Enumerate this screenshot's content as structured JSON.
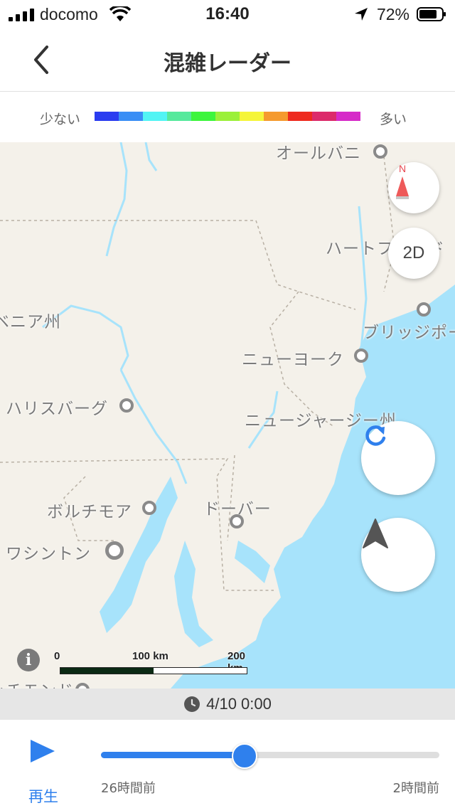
{
  "status_bar": {
    "carrier": "docomo",
    "time": "16:40",
    "battery_percent": "72%"
  },
  "nav": {
    "title": "混雑レーダー",
    "back_icon": "chevron-left-icon"
  },
  "legend": {
    "low_label": "少ない",
    "high_label": "多い",
    "colors": [
      "#2a3cf0",
      "#3a8ef5",
      "#52f4f4",
      "#56e99c",
      "#3df53d",
      "#9bf03a",
      "#f5f53a",
      "#f59a2e",
      "#ee2a1e",
      "#dc2a6a",
      "#d62ac8"
    ]
  },
  "map": {
    "labels": {
      "albany": "オールバニ",
      "hartford": "ハートフォード",
      "pennsylvania": "ペンシルベニア州",
      "bridgeport": "ブリッジポート",
      "new_york": "ニューヨーク",
      "harrisburg": "ハリスバーグ",
      "new_jersey": "ニュージャージー州",
      "baltimore": "ボルチモア",
      "dover": "ドーバー",
      "washington": "ワシントン",
      "richmond": "リッチモンド"
    },
    "compass_label": "N",
    "mode_label": "2D",
    "scale": {
      "tick0": "0",
      "tick1": "100 km",
      "tick2": "200 km"
    },
    "info_label": "i"
  },
  "time_strip": {
    "value": "4/10 0:00",
    "icon": "clock-icon"
  },
  "player": {
    "play_label": "再生",
    "slider_start_label": "26時間前",
    "slider_end_label": "2時間前",
    "slider_value": 0.42
  }
}
